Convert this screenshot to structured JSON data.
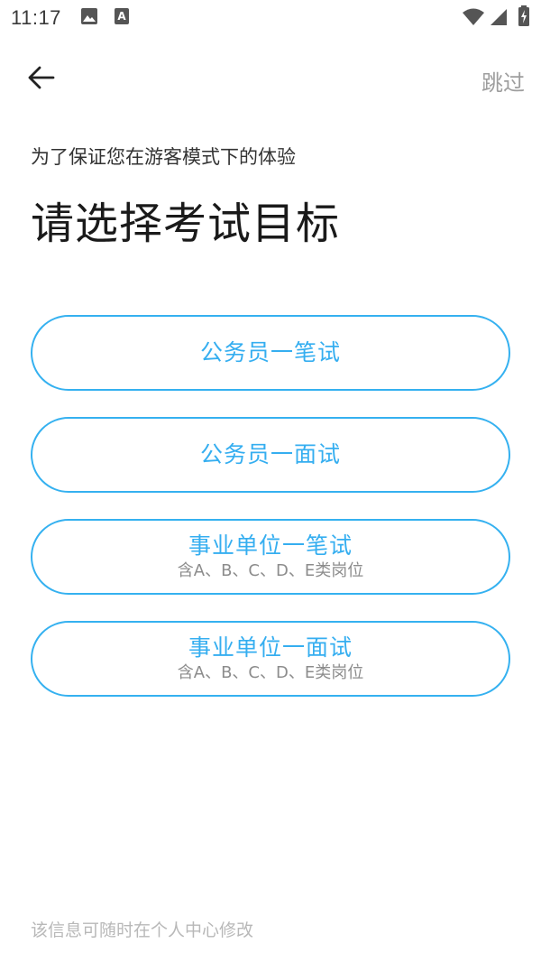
{
  "status_bar": {
    "time": "11:17",
    "icons": [
      "image-icon",
      "text-a-icon",
      "wifi-icon",
      "signal-icon",
      "battery-charging-icon"
    ]
  },
  "top_bar": {
    "back_icon": "arrow-left-icon",
    "skip_label": "跳过"
  },
  "header": {
    "subtitle": "为了保证您在游客模式下的体验",
    "title": "请选择考试目标"
  },
  "options": [
    {
      "label": "公务员一笔试",
      "note": ""
    },
    {
      "label": "公务员一面试",
      "note": ""
    },
    {
      "label": "事业单位一笔试",
      "note": "含A、B、C、D、E类岗位"
    },
    {
      "label": "事业单位一面试",
      "note": "含A、B、C、D、E类岗位"
    }
  ],
  "footer": {
    "note": "该信息可随时在个人中心修改"
  },
  "colors": {
    "accent": "#35b1f0",
    "muted_text": "#9e9e9e",
    "title_text": "#1a1a1a"
  }
}
